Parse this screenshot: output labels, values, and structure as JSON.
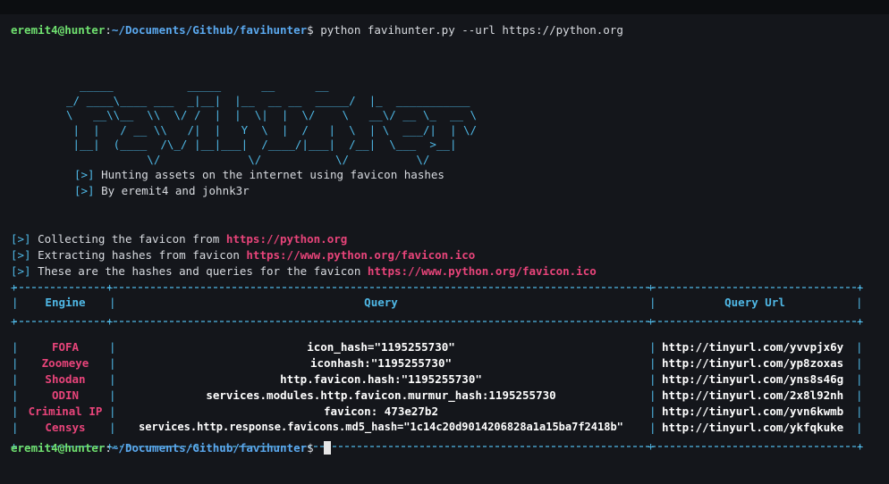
{
  "prompt": {
    "user": "eremit4@hunter",
    "path": "~/Documents/Github/favihunter",
    "symbol": "$",
    "command": "python favihunter.py --url https://python.org"
  },
  "banner_lines": [
    "  _____           _____      __      __",
    "_/ ____\\____ ___  _|__|  |__  __ __  _____/  |_  ___________",
    "\\   __\\\\__  \\\\  \\/ /  |  |  \\|  |  \\/    \\   __\\/ __ \\_  __ \\",
    " |  |   / __ \\\\   /|  |   Y  \\  |  /   |  \\  | \\  ___/|  | \\/",
    " |__|  (____  /\\_/ |__|___|  /____/|___|  /__|  \\___  >__|",
    "            \\/             \\/           \\/          \\/"
  ],
  "taglines": [
    "Hunting assets on the internet using favicon hashes",
    "By eremit4 and johnk3r"
  ],
  "bracket": "[>]",
  "messages": [
    {
      "text": "Collecting the favicon from ",
      "url": "https://python.org"
    },
    {
      "text": "Extracting hashes from favicon ",
      "url": "https://www.python.org/favicon.ico"
    },
    {
      "text": "These are the hashes and queries for the favicon ",
      "url": "https://www.python.org/favicon.ico"
    }
  ],
  "table": {
    "border_top": "+-----------+--------------------------------------------------------------------------------+------------------------------+",
    "border_sep": "+-----------+--------------------------------------------------------------------------------+------------------------------+",
    "border_bottom": "+-----------+--------------------------------------------------------------------------------+------------------------------+",
    "headers": [
      "Engine",
      "Query",
      "Query Url"
    ],
    "rows": [
      {
        "engine": "FOFA",
        "query": "icon_hash=\"1195255730\"",
        "url": "http://tinyurl.com/yvvpjx6y"
      },
      {
        "engine": "Zoomeye",
        "query": "iconhash:\"1195255730\"",
        "url": "http://tinyurl.com/yp8zoxas"
      },
      {
        "engine": "Shodan",
        "query": "http.favicon.hash:\"1195255730\"",
        "url": "http://tinyurl.com/yns8s46g"
      },
      {
        "engine": "ODIN",
        "query": "services.modules.http.favicon.murmur_hash:1195255730",
        "url": "http://tinyurl.com/2x8l92nh"
      },
      {
        "engine": "Criminal IP",
        "query": "favicon: 473e27b2",
        "url": "http://tinyurl.com/yvn6kwmb"
      },
      {
        "engine": "Censys",
        "query": "services.http.response.favicons.md5_hash=\"1c14c20d9014206828a1a15ba7f2418b\"",
        "url": "http://tinyurl.com/ykfqkuke"
      }
    ]
  },
  "colors": {
    "background": "#14161b",
    "accent": "#4fb8e6",
    "url": "#e8447a",
    "prompt_user": "#6fe06f",
    "prompt_path": "#5aa8ee"
  }
}
